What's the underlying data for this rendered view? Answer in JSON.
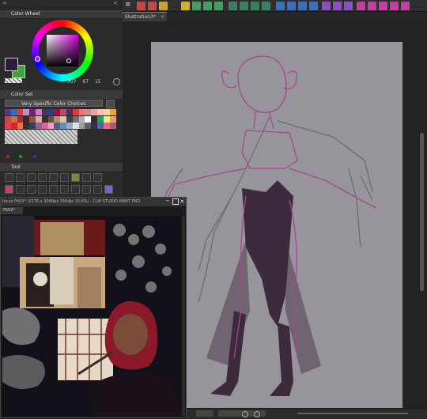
{
  "left_panel": {
    "color_wheel_title": "Color Wheel",
    "values": {
      "h": "307",
      "s": "67",
      "v": "15"
    },
    "color_set_title": "Color Set",
    "color_set_select": "Very Specific Color Choices",
    "tool_title": "Tool"
  },
  "canvas_tab": {
    "title": "Illustration3*"
  },
  "floating_window": {
    "title": "focus FK02* (2276 x 3300px 350dpi 15.6%) - CLIP STUDIO PAINT PRO",
    "tab": "FK02*"
  },
  "colors": {
    "primary": "#2d1b3a",
    "secondary": "#3fa43c",
    "canvas_bg": "#98949b"
  },
  "palette": [
    "#5b3a7a",
    "#3a6ad0",
    "#d04040",
    "#c08bd0",
    "#6a2a6a",
    "#e070c0",
    "#3a3a5a",
    "#2040a0",
    "#a01040",
    "#c04a6a",
    "#503060",
    "#e03a3a",
    "#f07080",
    "#c09090",
    "#f0a0a0",
    "#f0c0b0",
    "#f5d0a0",
    "#f0a030",
    "#c04a4a",
    "#d07040",
    "#a03030",
    "#502020",
    "#905050",
    "#d0b0a0",
    "#3a2a2a",
    "#705040",
    "#b09070",
    "#e0c0a0",
    "#404040",
    "#707070",
    "#b0b0b0",
    "#ffffff",
    "#303030",
    "#20a060",
    "#f0f070",
    "#e8a070",
    "#e04060",
    "#e02020",
    "#f07050",
    "#303030",
    "#304060",
    "#a05a90",
    "#e060a0",
    "#f0a0c0",
    "#506080",
    "#6090c0",
    "#90b0d0",
    "#e0e0e0",
    "#a0a0a0",
    "#606060",
    "#303050",
    "#6060a0",
    "#f06090",
    "#a06080"
  ]
}
